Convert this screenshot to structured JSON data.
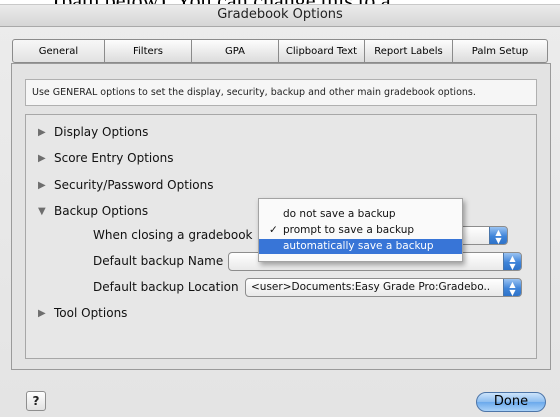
{
  "background_fragment": "(path below).  You can change this to a",
  "window": {
    "title": "Gradebook Options"
  },
  "tabs": [
    {
      "label": "General",
      "active": true
    },
    {
      "label": "Filters",
      "active": false
    },
    {
      "label": "GPA",
      "active": false
    },
    {
      "label": "Clipboard Text",
      "active": false
    },
    {
      "label": "Report Labels",
      "active": false
    },
    {
      "label": "Palm Setup",
      "active": false
    }
  ],
  "hint": "Use GENERAL options to set the display, security, backup and other main gradebook options.",
  "sections": [
    {
      "label": "Display Options",
      "expanded": false
    },
    {
      "label": "Score Entry Options",
      "expanded": false
    },
    {
      "label": "Security/Password Options",
      "expanded": false
    },
    {
      "label": "Backup Options",
      "expanded": true
    },
    {
      "label": "Tool Options",
      "expanded": false
    }
  ],
  "backup": {
    "closing_label": "When closing a gradebook",
    "closing_options": [
      {
        "label": "do not save a backup",
        "checked": false,
        "highlighted": false
      },
      {
        "label": "prompt to save a backup",
        "checked": true,
        "highlighted": false
      },
      {
        "label": "automatically save a backup",
        "checked": false,
        "highlighted": true
      }
    ],
    "name_label": "Default backup Name",
    "name_value": "",
    "location_label": "Default backup Location",
    "location_value": "<user>Documents:Easy Grade Pro:Gradebo..",
    "check_glyph": "✓"
  },
  "footer": {
    "help_label": "?",
    "done_label": "Done"
  },
  "colors": {
    "accent": "#3875d7",
    "popup_cap": "#3f84d9"
  }
}
